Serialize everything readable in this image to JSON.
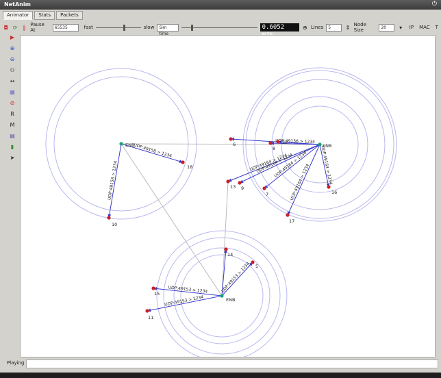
{
  "window": {
    "title": "NetAnim"
  },
  "tabs": [
    "Animator",
    "Stats",
    "Packets"
  ],
  "toolbar": {
    "pause_at_label": "Pause At",
    "pause_at_value": "65535",
    "fast_label": "fast",
    "slow_label": "slow",
    "sim_time_label": "Sim time",
    "sim_time_display": "0.6052 NZS",
    "lines_label": "Lines",
    "lines_value": "5",
    "node_size_label": "Node Size",
    "node_size_value": "20",
    "ip_label": "IP",
    "mac_label": "MAC",
    "t_label": "T"
  },
  "status": {
    "text": "Playing"
  },
  "nodes": [
    {
      "id": "enb1",
      "label": "ENB",
      "color": "#1aa079"
    },
    {
      "id": "n18",
      "label": "18",
      "color": "#c8202a"
    },
    {
      "id": "n10",
      "label": "10",
      "color": "#c8202a"
    },
    {
      "id": "enb2",
      "label": "ENB",
      "color": "#1aa079"
    },
    {
      "id": "n6",
      "label": "6",
      "color": "#c8202a"
    },
    {
      "id": "n8",
      "label": "8",
      "color": "#c8202a"
    },
    {
      "id": "n12",
      "label": "12",
      "color": "#c8202a"
    },
    {
      "id": "n13",
      "label": "13",
      "color": "#c8202a"
    },
    {
      "id": "n9",
      "label": "9",
      "color": "#c8202a"
    },
    {
      "id": "n7",
      "label": "7",
      "color": "#c8202a"
    },
    {
      "id": "n17",
      "label": "17",
      "color": "#c8202a"
    },
    {
      "id": "n16",
      "label": "16",
      "color": "#c8202a"
    },
    {
      "id": "enb3",
      "label": "ENB",
      "color": "#1aa079"
    },
    {
      "id": "n14",
      "label": "14",
      "color": "#c8202a"
    },
    {
      "id": "n5",
      "label": "5",
      "color": "#c8202a"
    },
    {
      "id": "n15",
      "label": "15",
      "color": "#c8202a"
    },
    {
      "id": "n11",
      "label": "11",
      "color": "#c8202a"
    }
  ],
  "packet_labels": [
    "UDP:49158 > 1234",
    "UDP:49158 > 1234",
    "UDP:49164 > 1234",
    "UDP:49164 > 1234",
    "UDP:49156 > 1234",
    "UDP:49164 > 1234",
    "UDP:49153 > 1234",
    "UDP:49153 > 1234",
    "UDP:49153 > 1234"
  ],
  "colors": {
    "link": "#3a3acc",
    "range": "#b8b8ee",
    "p2p": "#bbbbbb"
  }
}
